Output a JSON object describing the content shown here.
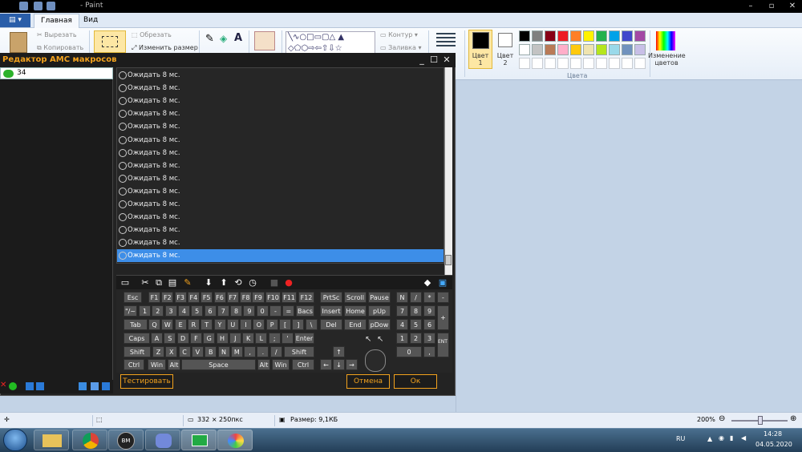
{
  "paint": {
    "title": "- Paint",
    "tabs": [
      "Главная",
      "Вид"
    ],
    "clipboard": {
      "cut": "Вырезать",
      "copy": "Копировать"
    },
    "image": {
      "crop": "Обрезать",
      "resize": "Изменить размер"
    },
    "shapes": {
      "outline": "Контур",
      "fill": "Заливка"
    },
    "color1": "Цвет 1",
    "color2": "Цвет 2",
    "edit_colors": "Изменение цветов",
    "colors_group": "Цвета",
    "palette_row1": [
      "#000000",
      "#7f7f7f",
      "#880015",
      "#ed1c24",
      "#ff7f27",
      "#fff200",
      "#22b14c",
      "#00a2e8",
      "#3f48cc",
      "#a349a4"
    ],
    "palette_row2": [
      "#ffffff",
      "#c3c3c3",
      "#b97a57",
      "#ffaec9",
      "#ffc90e",
      "#efe4b0",
      "#b5e61d",
      "#99d9ea",
      "#7092be",
      "#c8bfe7"
    ],
    "status": {
      "size": "332 × 250пкс",
      "filesize": "Размер: 9,1КБ",
      "zoom": "200%"
    }
  },
  "amc": {
    "title": "Редактор АМС макросов",
    "macro_name": "34",
    "list_item": "Ожидать 8 мс.",
    "list_count": 15,
    "test_button": "Тестировать",
    "cancel_button": "Отмена",
    "ok_button": "Ок"
  },
  "keyboard": {
    "row1": [
      "Esc",
      "F1",
      "F2",
      "F3",
      "F4",
      "F5",
      "F6",
      "F7",
      "F8",
      "F9",
      "F10",
      "F11",
      "F12"
    ],
    "row2": [
      "\"/~",
      "1",
      "2",
      "3",
      "4",
      "5",
      "6",
      "7",
      "8",
      "9",
      "0",
      "-",
      "=",
      "Bacs"
    ],
    "row3": [
      "Tab",
      "Q",
      "W",
      "E",
      "R",
      "T",
      "Y",
      "U",
      "I",
      "O",
      "P",
      "[",
      "]",
      "\\"
    ],
    "row4": [
      "Caps",
      "A",
      "S",
      "D",
      "F",
      "G",
      "H",
      "J",
      "K",
      "L",
      ";",
      "'",
      "Enter"
    ],
    "row5": [
      "Shift",
      "Z",
      "X",
      "C",
      "V",
      "B",
      "N",
      "M",
      ",",
      ".",
      "/",
      "Shift"
    ],
    "row6": [
      "Ctrl",
      "Win",
      "Alt",
      "Space",
      "Alt",
      "Win",
      "Ctrl"
    ],
    "nav1": [
      "PrtSc",
      "Scroll",
      "Pause"
    ],
    "nav2": [
      "Insert",
      "Home",
      "pUp"
    ],
    "nav3": [
      "Del",
      "End",
      "pDow"
    ],
    "numpad": [
      "N",
      "/",
      "*",
      "-",
      "7",
      "8",
      "9",
      "+",
      "4",
      "5",
      "6",
      "1",
      "2",
      "3",
      "ENT ER",
      "0",
      ","
    ],
    "arrows": [
      "↑",
      "←",
      "↓",
      "→"
    ]
  },
  "tray": {
    "lang": "RU",
    "time": "14:28",
    "date": "04.05.2020"
  }
}
